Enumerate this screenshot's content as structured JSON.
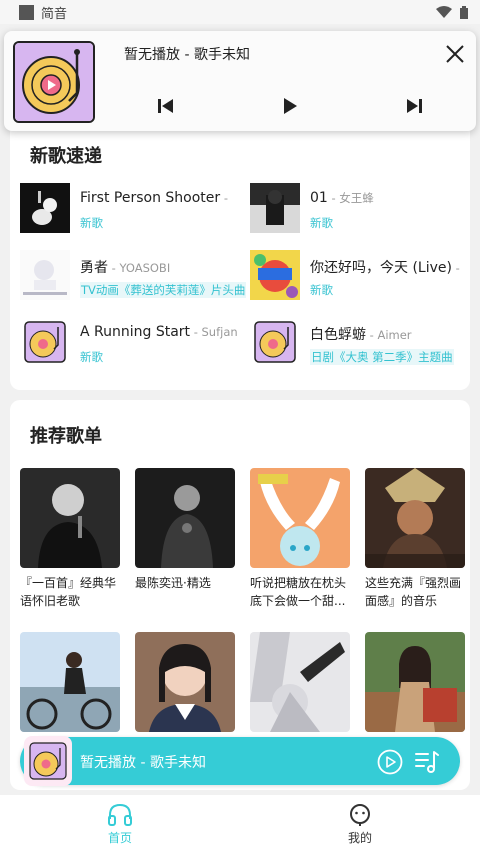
{
  "status_bar": {
    "app_name": "简音"
  },
  "notification": {
    "title": "暂无播放 - 歌手未知",
    "icons": {
      "close": "close-icon",
      "prev": "previous-icon",
      "play": "play-icon",
      "next": "next-icon"
    }
  },
  "new_songs": {
    "title": "新歌速递",
    "items": [
      {
        "name": "First Person Shooter",
        "artist": " - ",
        "tag": "新歌"
      },
      {
        "name": "01",
        "artist": " - 女王蜂",
        "tag": "新歌"
      },
      {
        "name": "勇者",
        "artist": " - YOASOBI",
        "tag": "TV动画《葬送的芙莉莲》片头曲"
      },
      {
        "name": "你还好吗，今天 (Live)",
        "artist": " - ",
        "tag": "新歌"
      },
      {
        "name": "A Running Start",
        "artist": " - Sufjan",
        "tag": "新歌"
      },
      {
        "name": "白色蜉蝣",
        "artist": " - Aimer",
        "tag": "日剧《大奥 第二季》主题曲"
      }
    ]
  },
  "playlists": {
    "title": "推荐歌单",
    "items": [
      {
        "caption": "『一百首』经典华语怀旧老歌"
      },
      {
        "caption": "最陈奕迅·精选"
      },
      {
        "caption": "听说把糖放在枕头底下会做一个甜..."
      },
      {
        "caption": "这些充满『强烈画面感』的音乐"
      },
      {
        "caption": ""
      },
      {
        "caption": ""
      },
      {
        "caption": ""
      },
      {
        "caption": ""
      }
    ]
  },
  "mini_player": {
    "title": "暂无播放 - 歌手未知"
  },
  "bottom_nav": {
    "home": "首页",
    "mine": "我的"
  },
  "colors": {
    "accent": "#35ccd6",
    "tag": "#34c2d0"
  }
}
